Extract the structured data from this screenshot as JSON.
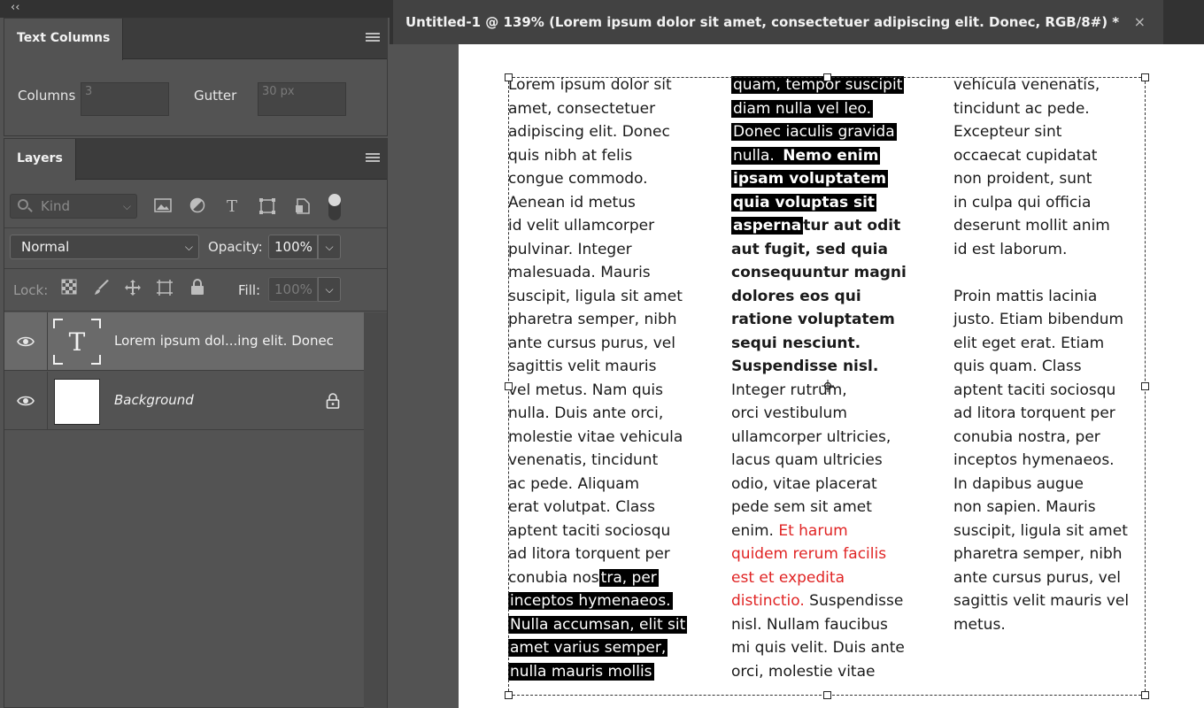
{
  "panels": {
    "collapse_icon": "‹‹",
    "text_columns": {
      "tab": "Text Columns",
      "columns_label": "Columns",
      "columns_value": "3",
      "gutter_label": "Gutter",
      "gutter_value": "30 px"
    },
    "layers": {
      "tab": "Layers",
      "filter_placeholder": "Kind",
      "blend_mode": "Normal",
      "opacity_label": "Opacity:",
      "opacity_value": "100%",
      "lock_label": "Lock:",
      "fill_label": "Fill:",
      "fill_value": "100%",
      "items": [
        {
          "name": "Lorem ipsum dol...ing elit. Donec",
          "type": "text",
          "visible": true,
          "selected": true,
          "thumb_glyph": "T"
        },
        {
          "name": "Background",
          "type": "background",
          "visible": true,
          "selected": false,
          "locked": true
        }
      ]
    }
  },
  "document": {
    "tab_title": "Untitled-1 @ 139% (Lorem ipsum dolor sit amet, consectetuer adipiscing elit. Donec, RGB/8#) *",
    "close_glyph": "×",
    "colors": {
      "highlight": "#000000",
      "red_text": "#e02424"
    },
    "columns": [
      [
        [
          {
            "t": "Lorem ipsum dolor sit"
          }
        ],
        [
          {
            "t": "amet, consectetuer"
          }
        ],
        [
          {
            "t": "adipiscing elit. Donec"
          }
        ],
        [
          {
            "t": "quis nibh at felis"
          }
        ],
        [
          {
            "t": "congue commodo."
          }
        ],
        [
          {
            "t": "Aenean id metus"
          }
        ],
        [
          {
            "t": "id velit ullamcorper"
          }
        ],
        [
          {
            "t": "pulvinar. Integer"
          }
        ],
        [
          {
            "t": "malesuada. Mauris"
          }
        ],
        [
          {
            "t": "suscipit, ligula sit amet"
          }
        ],
        [
          {
            "t": "pharetra semper, nibh"
          }
        ],
        [
          {
            "t": "ante cursus purus, vel"
          }
        ],
        [
          {
            "t": "sagittis velit mauris"
          }
        ],
        [
          {
            "t": "vel metus. Nam quis"
          }
        ],
        [
          {
            "t": "nulla. Duis ante orci,"
          }
        ],
        [
          {
            "t": "molestie vitae vehicula"
          }
        ],
        [
          {
            "t": "venenatis, tincidunt"
          }
        ],
        [
          {
            "t": "ac pede. Aliquam"
          }
        ],
        [
          {
            "t": "erat volutpat. Class"
          }
        ],
        [
          {
            "t": "aptent taciti sociosqu"
          }
        ],
        [
          {
            "t": "ad litora torquent per"
          }
        ],
        [
          {
            "t": "conubia nos"
          },
          {
            "t": "tra, per",
            "hl": true
          }
        ],
        [
          {
            "t": "inceptos hymenaeos.",
            "hl": true
          }
        ],
        [
          {
            "t": "Nulla accumsan, elit sit",
            "hl": true
          }
        ],
        [
          {
            "t": "amet varius semper,",
            "hl": true
          }
        ],
        [
          {
            "t": "nulla mauris mollis",
            "hl": true
          }
        ]
      ],
      [
        [
          {
            "t": "quam, tempor suscipit",
            "hl": true
          }
        ],
        [
          {
            "t": "diam nulla vel leo.",
            "hl": true
          }
        ],
        [
          {
            "t": "Donec iaculis gravida",
            "hl": true
          }
        ],
        [
          {
            "t": "nulla. ",
            "hl": true
          },
          {
            "t": "Nemo enim",
            "hl": true,
            "b": true
          }
        ],
        [
          {
            "t": "ipsam voluptatem",
            "hl": true,
            "b": true
          }
        ],
        [
          {
            "t": "quia voluptas sit",
            "hl": true,
            "b": true
          }
        ],
        [
          {
            "t": "asperna",
            "hl": true,
            "b": true
          },
          {
            "t": "tur aut odit",
            "b": true
          }
        ],
        [
          {
            "t": "aut fugit, sed quia",
            "b": true
          }
        ],
        [
          {
            "t": "consequuntur magni",
            "b": true
          }
        ],
        [
          {
            "t": "dolores eos qui",
            "b": true
          }
        ],
        [
          {
            "t": "ratione voluptatem",
            "b": true
          }
        ],
        [
          {
            "t": "sequi nesciunt.",
            "b": true
          }
        ],
        [
          {
            "t": "Suspendisse nisl.",
            "b": true
          }
        ],
        [
          {
            "t": "Integer rutrum,"
          }
        ],
        [
          {
            "t": "orci vestibulum"
          }
        ],
        [
          {
            "t": "ullamcorper ultricies,"
          }
        ],
        [
          {
            "t": "lacus quam ultricies"
          }
        ],
        [
          {
            "t": "odio, vitae placerat"
          }
        ],
        [
          {
            "t": "pede sem sit amet"
          }
        ],
        [
          {
            "t": "enim. "
          },
          {
            "t": "Et harum",
            "red": true
          }
        ],
        [
          {
            "t": "quidem rerum facilis",
            "red": true
          }
        ],
        [
          {
            "t": "est et expedita",
            "red": true
          }
        ],
        [
          {
            "t": "distinctio.",
            "red": true
          },
          {
            "t": " Suspendisse"
          }
        ],
        [
          {
            "t": "nisl. Nullam faucibus"
          }
        ],
        [
          {
            "t": "mi quis velit. Duis ante"
          }
        ],
        [
          {
            "t": "orci, molestie vitae"
          }
        ]
      ],
      [
        [
          {
            "t": "vehicula venenatis,"
          }
        ],
        [
          {
            "t": "tincidunt ac pede."
          }
        ],
        [
          {
            "t": "Excepteur sint"
          }
        ],
        [
          {
            "t": "occaecat cupidatat"
          }
        ],
        [
          {
            "t": "non proident, sunt"
          }
        ],
        [
          {
            "t": "in culpa qui officia"
          }
        ],
        [
          {
            "t": "deserunt mollit anim"
          }
        ],
        [
          {
            "t": "id est laborum."
          }
        ],
        [],
        [
          {
            "t": "Proin mattis lacinia"
          }
        ],
        [
          {
            "t": "justo. Etiam bibendum"
          }
        ],
        [
          {
            "t": "elit eget erat. Etiam"
          }
        ],
        [
          {
            "t": "quis quam. Class"
          }
        ],
        [
          {
            "t": "aptent taciti sociosqu"
          }
        ],
        [
          {
            "t": "ad litora torquent per"
          }
        ],
        [
          {
            "t": "conubia nostra, per"
          }
        ],
        [
          {
            "t": "inceptos hymenaeos."
          }
        ],
        [
          {
            "t": "In dapibus augue"
          }
        ],
        [
          {
            "t": "non sapien. Mauris"
          }
        ],
        [
          {
            "t": "suscipit, ligula sit amet"
          }
        ],
        [
          {
            "t": "pharetra semper, nibh"
          }
        ],
        [
          {
            "t": "ante cursus purus, vel"
          }
        ],
        [
          {
            "t": "sagittis velit mauris vel"
          }
        ],
        [
          {
            "t": "metus."
          }
        ]
      ]
    ]
  }
}
